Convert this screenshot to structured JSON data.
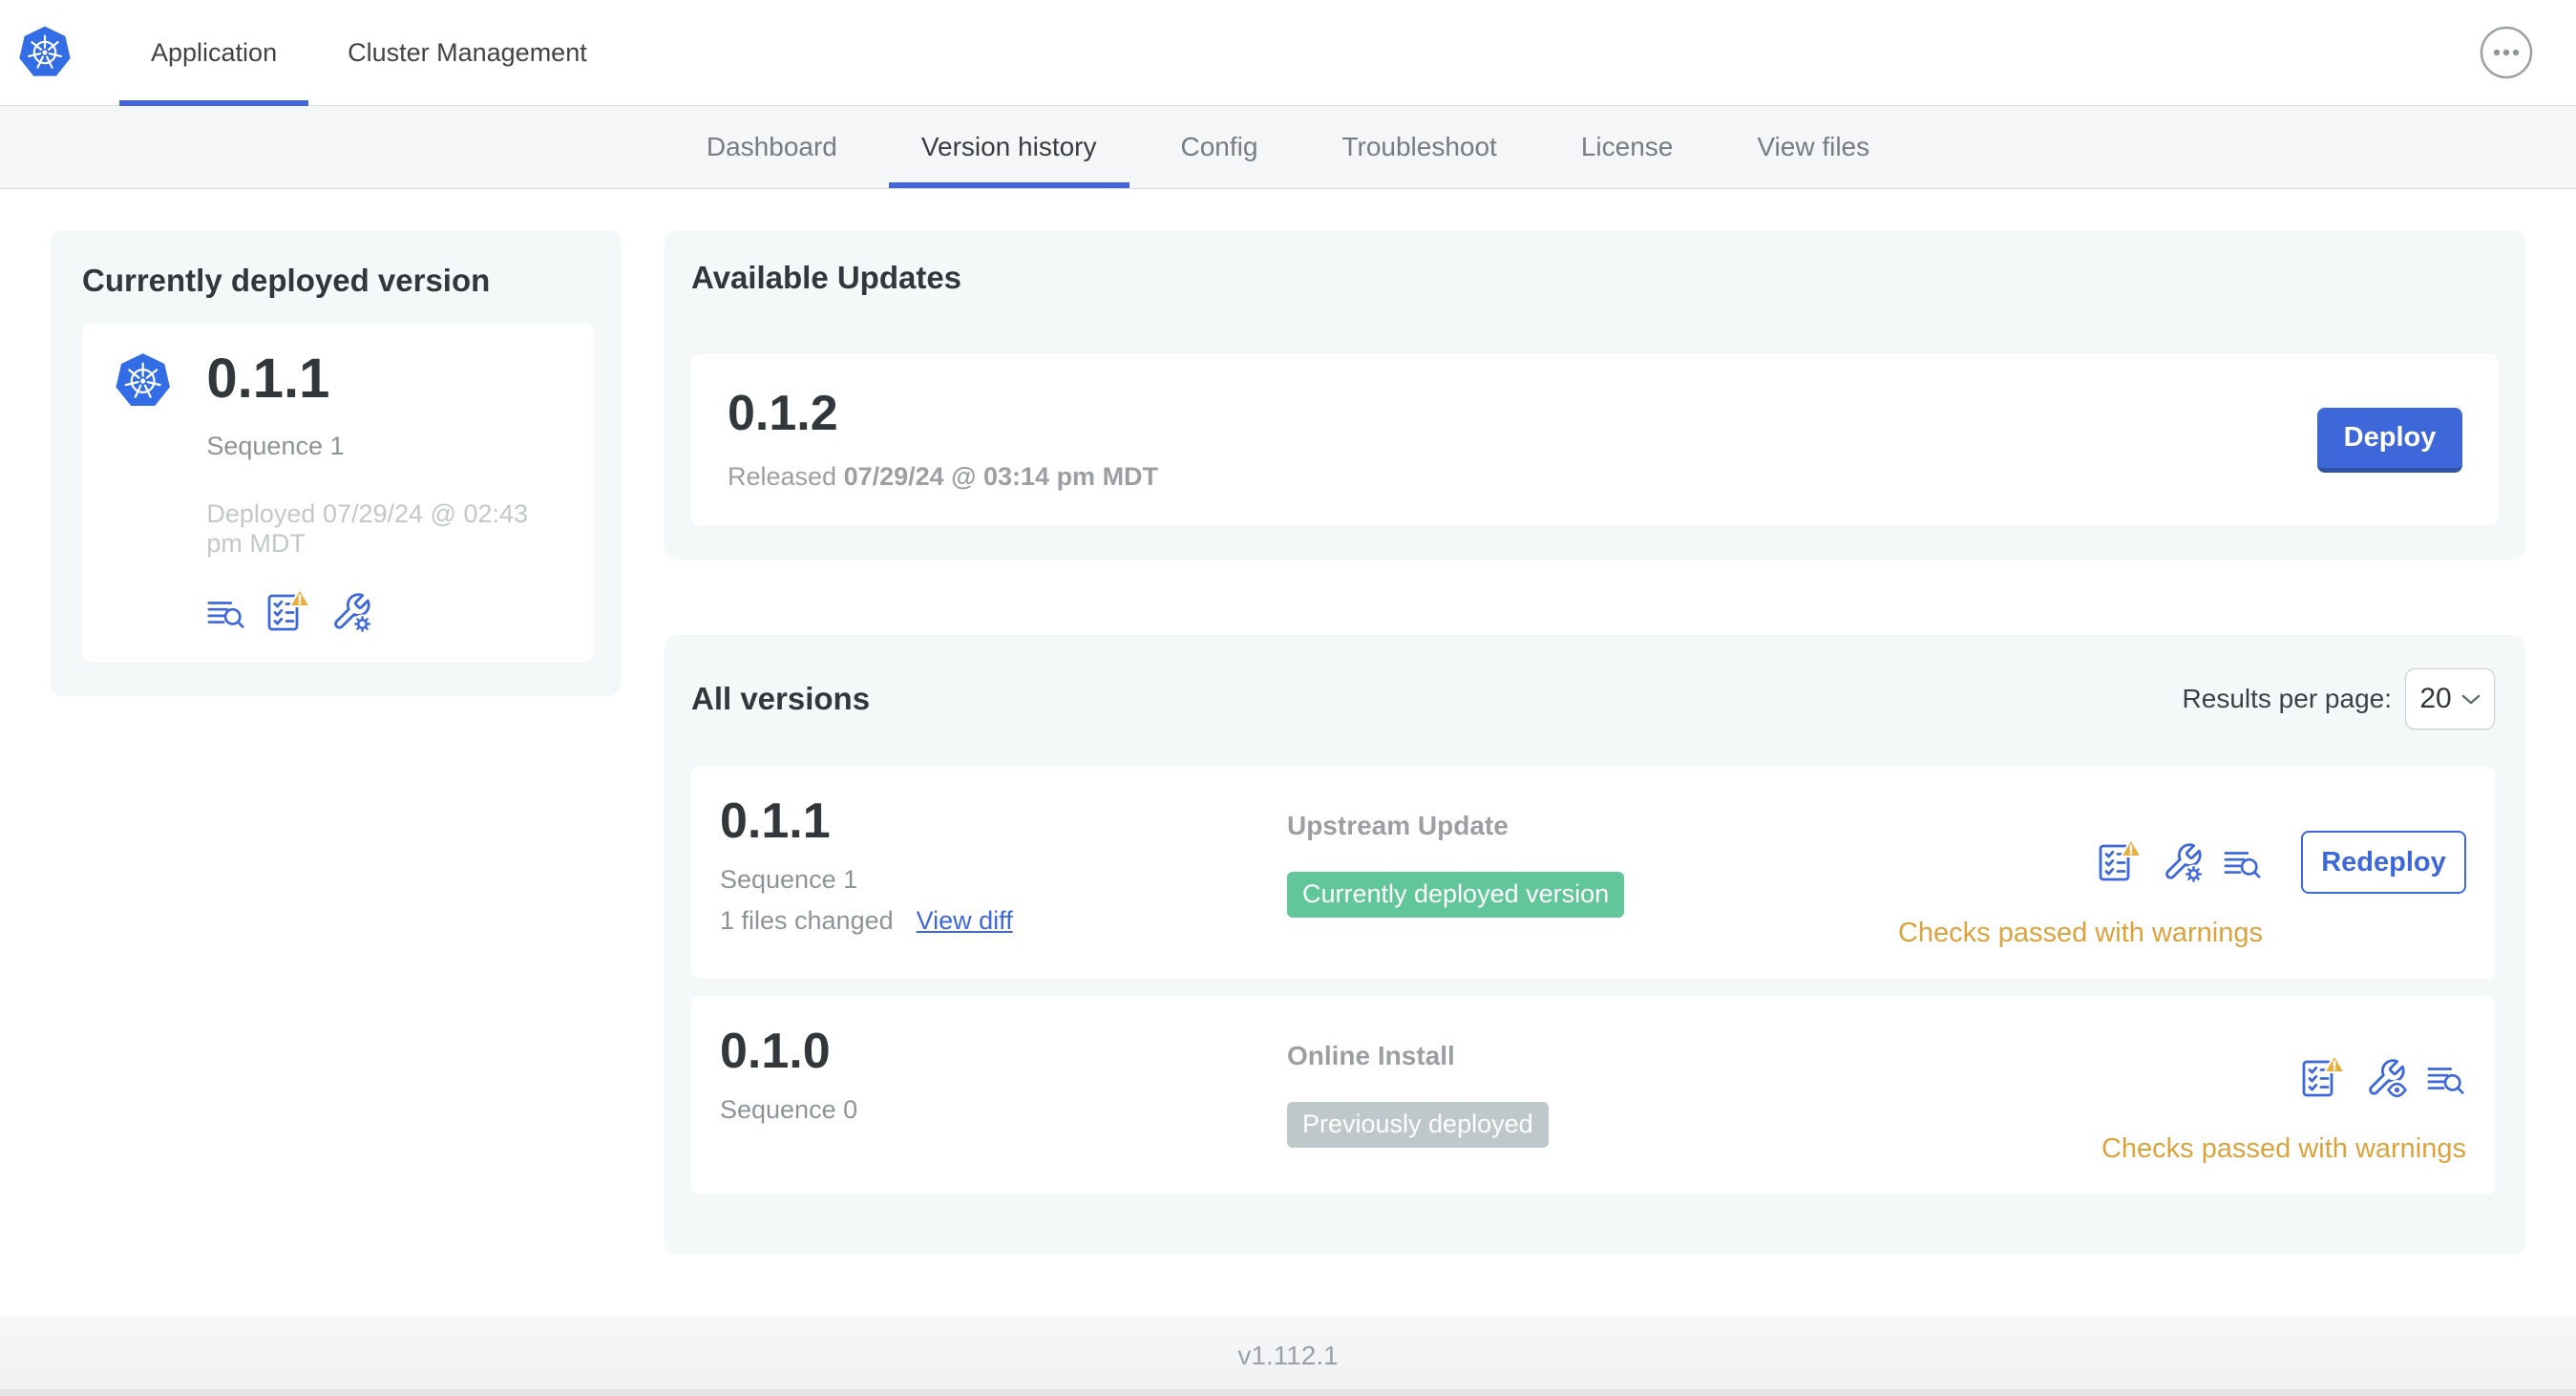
{
  "header": {
    "logo_alt": "kubernetes-logo",
    "tabs": [
      {
        "label": "Application",
        "active": true
      },
      {
        "label": "Cluster Management",
        "active": false
      }
    ]
  },
  "subnav": {
    "tabs": [
      {
        "label": "Dashboard",
        "active": false
      },
      {
        "label": "Version history",
        "active": true
      },
      {
        "label": "Config",
        "active": false
      },
      {
        "label": "Troubleshoot",
        "active": false
      },
      {
        "label": "License",
        "active": false
      },
      {
        "label": "View files",
        "active": false
      }
    ]
  },
  "deployed_card": {
    "title": "Currently deployed version",
    "version": "0.1.1",
    "sequence": "Sequence 1",
    "deployed_at": "Deployed 07/29/24 @ 02:43 pm MDT"
  },
  "available_updates": {
    "title": "Available Updates",
    "version": "0.1.2",
    "released_prefix": "Released",
    "released_at": "07/29/24 @ 03:14 pm MDT",
    "deploy_label": "Deploy"
  },
  "all_versions": {
    "title": "All versions",
    "results_per_page_label": "Results per page:",
    "results_per_page_value": "20",
    "rows": [
      {
        "version": "0.1.1",
        "sequence": "Sequence 1",
        "files_changed": "1 files changed",
        "view_diff_label": "View diff",
        "source": "Upstream Update",
        "badge": "Currently deployed version",
        "badge_color": "#61c699",
        "status": "Checks passed with warnings",
        "action_label": "Redeploy"
      },
      {
        "version": "0.1.0",
        "sequence": "Sequence 0",
        "source": "Online Install",
        "badge": "Previously deployed",
        "badge_color": "#bec7ca",
        "status": "Checks passed with warnings"
      }
    ]
  },
  "footer": {
    "app_version": "v1.112.1"
  },
  "colors": {
    "accent_blue": "#3e68d9",
    "underline_blue": "#4065dd",
    "kubernetes_blue": "#326de6",
    "warning_amber": "#dca23c",
    "badge_green": "#61c699",
    "badge_gray": "#bec7ca",
    "panel_gray": "#f5f8f9"
  }
}
